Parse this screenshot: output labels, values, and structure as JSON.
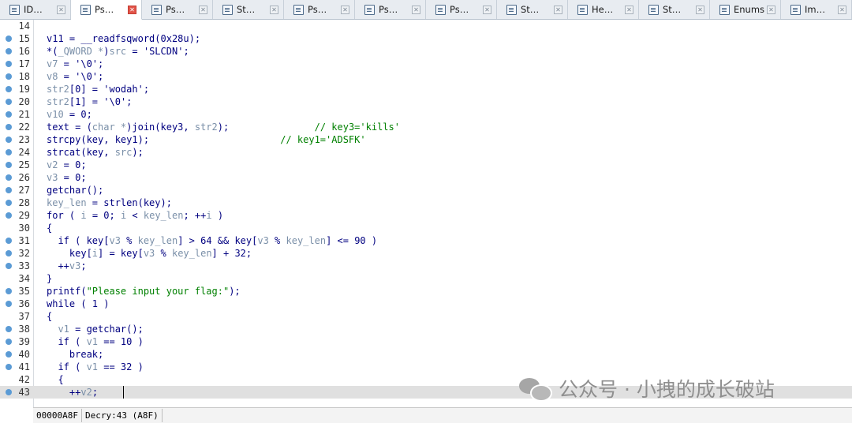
{
  "tabs": [
    {
      "label": "ID…",
      "active": false,
      "icon": "view-icon"
    },
    {
      "label": "Ps…",
      "active": true,
      "icon": "pseudocode-icon"
    },
    {
      "label": "Ps…",
      "active": false,
      "icon": "pseudocode-icon"
    },
    {
      "label": "St…",
      "active": false,
      "icon": "structures-icon"
    },
    {
      "label": "Ps…",
      "active": false,
      "icon": "pseudocode-icon"
    },
    {
      "label": "Ps…",
      "active": false,
      "icon": "pseudocode-icon"
    },
    {
      "label": "Ps…",
      "active": false,
      "icon": "pseudocode-icon"
    },
    {
      "label": "St…",
      "active": false,
      "icon": "stack-icon"
    },
    {
      "label": "He…",
      "active": false,
      "icon": "hex-icon"
    },
    {
      "label": "St…",
      "active": false,
      "icon": "strings-icon"
    },
    {
      "label": "Enums",
      "active": false,
      "icon": "enums-icon"
    },
    {
      "label": "Im…",
      "active": false,
      "icon": "imports-icon"
    }
  ],
  "tab_close_glyph": "✕",
  "code_lines": [
    {
      "num": "14",
      "dot": false,
      "tokens": []
    },
    {
      "num": "15",
      "dot": true,
      "tokens": [
        {
          "t": "v11 = __readfsqword(0x28u);",
          "c": "kw"
        }
      ]
    },
    {
      "num": "16",
      "dot": true,
      "tokens": [
        {
          "t": "*(",
          "c": "kw"
        },
        {
          "t": "_QWORD *",
          "c": "var"
        },
        {
          "t": ")",
          "c": "kw"
        },
        {
          "t": "src",
          "c": "var"
        },
        {
          "t": " = ",
          "c": "kw"
        },
        {
          "t": "'SLCDN'",
          "c": "kw"
        },
        {
          "t": ";",
          "c": "kw"
        }
      ]
    },
    {
      "num": "17",
      "dot": true,
      "tokens": [
        {
          "t": "v7",
          "c": "var"
        },
        {
          "t": " = '\\0';",
          "c": "kw"
        }
      ]
    },
    {
      "num": "18",
      "dot": true,
      "tokens": [
        {
          "t": "v8",
          "c": "var"
        },
        {
          "t": " = '\\0';",
          "c": "kw"
        }
      ]
    },
    {
      "num": "19",
      "dot": true,
      "tokens": [
        {
          "t": "str2",
          "c": "var"
        },
        {
          "t": "[0] = 'wodah';",
          "c": "kw"
        }
      ]
    },
    {
      "num": "20",
      "dot": true,
      "tokens": [
        {
          "t": "str2",
          "c": "var"
        },
        {
          "t": "[1] = '\\0';",
          "c": "kw"
        }
      ]
    },
    {
      "num": "21",
      "dot": true,
      "tokens": [
        {
          "t": "v10",
          "c": "var"
        },
        {
          "t": " = 0;",
          "c": "kw"
        }
      ]
    },
    {
      "num": "22",
      "dot": true,
      "tokens": [
        {
          "t": "text = (",
          "c": "kw"
        },
        {
          "t": "char *",
          "c": "var"
        },
        {
          "t": ")join(key3, ",
          "c": "kw"
        },
        {
          "t": "str2",
          "c": "var"
        },
        {
          "t": ");               ",
          "c": "kw"
        },
        {
          "t": "// key3='kills'",
          "c": "cmt"
        }
      ]
    },
    {
      "num": "23",
      "dot": true,
      "tokens": [
        {
          "t": "strcpy(key, key1);                       ",
          "c": "kw"
        },
        {
          "t": "// key1='ADSFK'",
          "c": "cmt"
        }
      ]
    },
    {
      "num": "24",
      "dot": true,
      "tokens": [
        {
          "t": "strcat(key, ",
          "c": "kw"
        },
        {
          "t": "src",
          "c": "var"
        },
        {
          "t": ");",
          "c": "kw"
        }
      ]
    },
    {
      "num": "25",
      "dot": true,
      "tokens": [
        {
          "t": "v2",
          "c": "var"
        },
        {
          "t": " = 0;",
          "c": "kw"
        }
      ]
    },
    {
      "num": "26",
      "dot": true,
      "tokens": [
        {
          "t": "v3",
          "c": "var"
        },
        {
          "t": " = 0;",
          "c": "kw"
        }
      ]
    },
    {
      "num": "27",
      "dot": true,
      "tokens": [
        {
          "t": "getchar();",
          "c": "kw"
        }
      ]
    },
    {
      "num": "28",
      "dot": true,
      "tokens": [
        {
          "t": "key_len",
          "c": "var"
        },
        {
          "t": " = strlen(key);",
          "c": "kw"
        }
      ]
    },
    {
      "num": "29",
      "dot": true,
      "tokens": [
        {
          "t": "for ( ",
          "c": "kw"
        },
        {
          "t": "i",
          "c": "var"
        },
        {
          "t": " = 0; ",
          "c": "kw"
        },
        {
          "t": "i",
          "c": "var"
        },
        {
          "t": " < ",
          "c": "kw"
        },
        {
          "t": "key_len",
          "c": "var"
        },
        {
          "t": "; ++",
          "c": "kw"
        },
        {
          "t": "i",
          "c": "var"
        },
        {
          "t": " )",
          "c": "kw"
        }
      ]
    },
    {
      "num": "30",
      "dot": false,
      "tokens": [
        {
          "t": "{",
          "c": "kw"
        }
      ]
    },
    {
      "num": "31",
      "dot": true,
      "tokens": [
        {
          "t": "  if ( key[",
          "c": "kw"
        },
        {
          "t": "v3",
          "c": "var"
        },
        {
          "t": " % ",
          "c": "kw"
        },
        {
          "t": "key_len",
          "c": "var"
        },
        {
          "t": "] > 64 && key[",
          "c": "kw"
        },
        {
          "t": "v3",
          "c": "var"
        },
        {
          "t": " % ",
          "c": "kw"
        },
        {
          "t": "key_len",
          "c": "var"
        },
        {
          "t": "] <= 90 )",
          "c": "kw"
        }
      ]
    },
    {
      "num": "32",
      "dot": true,
      "tokens": [
        {
          "t": "    key[",
          "c": "kw"
        },
        {
          "t": "i",
          "c": "var"
        },
        {
          "t": "] = key[",
          "c": "kw"
        },
        {
          "t": "v3",
          "c": "var"
        },
        {
          "t": " % ",
          "c": "kw"
        },
        {
          "t": "key_len",
          "c": "var"
        },
        {
          "t": "] + 32;",
          "c": "kw"
        }
      ]
    },
    {
      "num": "33",
      "dot": true,
      "tokens": [
        {
          "t": "  ++",
          "c": "kw"
        },
        {
          "t": "v3",
          "c": "var"
        },
        {
          "t": ";",
          "c": "kw"
        }
      ]
    },
    {
      "num": "34",
      "dot": false,
      "tokens": [
        {
          "t": "}",
          "c": "kw"
        }
      ]
    },
    {
      "num": "35",
      "dot": true,
      "tokens": [
        {
          "t": "printf(",
          "c": "kw"
        },
        {
          "t": "\"Please input your flag:\"",
          "c": "str"
        },
        {
          "t": ");",
          "c": "kw"
        }
      ]
    },
    {
      "num": "36",
      "dot": true,
      "tokens": [
        {
          "t": "while ( 1 )",
          "c": "kw"
        }
      ]
    },
    {
      "num": "37",
      "dot": false,
      "tokens": [
        {
          "t": "{",
          "c": "kw"
        }
      ]
    },
    {
      "num": "38",
      "dot": true,
      "tokens": [
        {
          "t": "  ",
          "c": "kw"
        },
        {
          "t": "v1",
          "c": "var"
        },
        {
          "t": " = getchar();",
          "c": "kw"
        }
      ]
    },
    {
      "num": "39",
      "dot": true,
      "tokens": [
        {
          "t": "  if ( ",
          "c": "kw"
        },
        {
          "t": "v1",
          "c": "var"
        },
        {
          "t": " == 10 )",
          "c": "kw"
        }
      ]
    },
    {
      "num": "40",
      "dot": true,
      "tokens": [
        {
          "t": "    break;",
          "c": "kw"
        }
      ]
    },
    {
      "num": "41",
      "dot": true,
      "tokens": [
        {
          "t": "  if ( ",
          "c": "kw"
        },
        {
          "t": "v1",
          "c": "var"
        },
        {
          "t": " == 32 )",
          "c": "kw"
        }
      ]
    },
    {
      "num": "42",
      "dot": false,
      "tokens": [
        {
          "t": "  {",
          "c": "kw"
        }
      ]
    },
    {
      "num": "43",
      "dot": true,
      "current": true,
      "tokens": [
        {
          "t": "    ++",
          "c": "kw"
        },
        {
          "t": "v2",
          "c": "var"
        },
        {
          "t": ";",
          "c": "kw"
        }
      ]
    }
  ],
  "status": {
    "address": "00000A8F",
    "location": "Decry:43 (A8F)"
  },
  "watermark": {
    "text": "公众号 · 小拽的成长破站",
    "icon": "wechat-icon"
  },
  "colors": {
    "keyword": "#000080",
    "variable": "#7a8fa8",
    "string": "#008000",
    "comment": "#008000",
    "breakpoint_dot": "#5b9bd5",
    "current_line": "#e0e0e0"
  }
}
